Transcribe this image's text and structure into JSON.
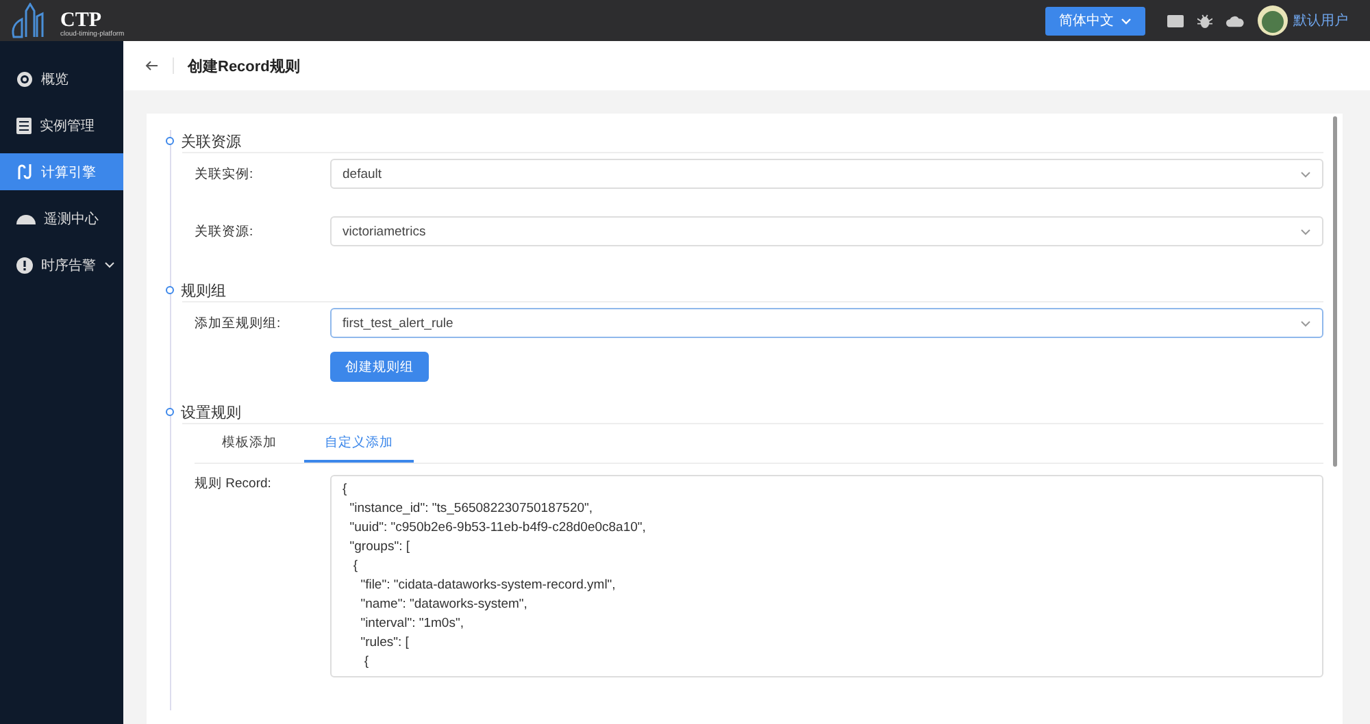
{
  "header": {
    "logo": {
      "name": "CTP",
      "subtitle": "cloud-timing-platform"
    },
    "language": "简体中文",
    "user": "默认用户"
  },
  "sidebar": {
    "items": [
      {
        "label": "概览",
        "kind": "target",
        "selected": false,
        "expandable": false
      },
      {
        "label": "实例管理",
        "kind": "list",
        "selected": false,
        "expandable": false
      },
      {
        "label": "计算引擎",
        "kind": "engine",
        "selected": true,
        "expandable": false
      },
      {
        "label": "遥测中心",
        "kind": "gauge",
        "selected": false,
        "expandable": false
      },
      {
        "label": "时序告警",
        "kind": "alert",
        "selected": false,
        "expandable": true
      }
    ]
  },
  "page": {
    "title": "创建Record规则"
  },
  "sections": [
    {
      "title": "关联资源",
      "fields": [
        {
          "label": "关联实例:",
          "value": "default",
          "focused": false
        },
        {
          "label": "关联资源:",
          "value": "victoriametrics",
          "focused": false
        }
      ]
    },
    {
      "title": "规则组",
      "fields": [
        {
          "label": "添加至规则组:",
          "value": "first_test_alert_rule",
          "focused": true
        }
      ],
      "button": "创建规则组"
    },
    {
      "title": "设置规则",
      "tabs": [
        {
          "label": "模板添加",
          "selected": false
        },
        {
          "label": "自定义添加",
          "selected": true
        }
      ],
      "editor": {
        "label": "规则 Record:",
        "lines": [
          "{",
          "  \"instance_id\": \"ts_565082230750187520\",",
          "  \"uuid\": \"c950b2e6-9b53-11eb-b4f9-c28d0e0c8a10\",",
          "  \"groups\": [",
          "   {",
          "     \"file\": \"cidata-dataworks-system-record.yml\",",
          "     \"name\": \"dataworks-system\",",
          "     \"interval\": \"1m0s\",",
          "     \"rules\": [",
          "      {"
        ]
      }
    }
  ]
}
